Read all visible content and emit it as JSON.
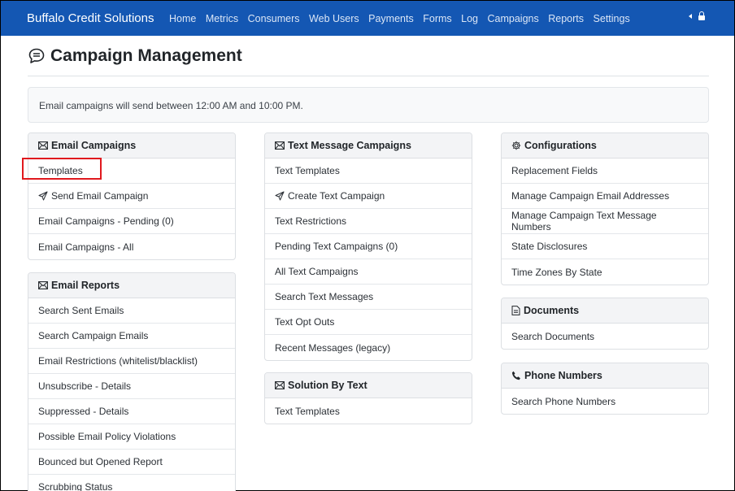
{
  "navbar": {
    "brand": "Buffalo Credit Solutions",
    "links": [
      "Home",
      "Metrics",
      "Consumers",
      "Web Users",
      "Payments",
      "Forms",
      "Log",
      "Campaigns",
      "Reports",
      "Settings"
    ],
    "right_icons": [
      "caret-left-icon",
      "lock-icon"
    ]
  },
  "page": {
    "title": "Campaign Management",
    "info": "Email campaigns will send between 12:00 AM and 10:00 PM."
  },
  "email_campaigns": {
    "title": "Email Campaigns",
    "items": [
      "Templates",
      "Send Email Campaign",
      "Email Campaigns - Pending (0)",
      "Email Campaigns - All"
    ]
  },
  "email_reports": {
    "title": "Email Reports",
    "items": [
      "Search Sent Emails",
      "Search Campaign Emails",
      "Email Restrictions (whitelist/blacklist)",
      "Unsubscribe - Details",
      "Suppressed - Details",
      "Possible Email Policy Violations",
      "Bounced but Opened Report",
      "Scrubbing Status"
    ]
  },
  "text_campaigns": {
    "title": "Text Message Campaigns",
    "items": [
      "Text Templates",
      "Create Text Campaign",
      "Text Restrictions",
      "Pending Text Campaigns (0)",
      "All Text Campaigns",
      "Search Text Messages",
      "Text Opt Outs",
      "Recent Messages (legacy)"
    ]
  },
  "solution_by_text": {
    "title": "Solution By Text",
    "items": [
      "Text Templates"
    ]
  },
  "configurations": {
    "title": "Configurations",
    "items": [
      "Replacement Fields",
      "Manage Campaign Email Addresses",
      "Manage Campaign Text Message Numbers",
      "State Disclosures",
      "Time Zones By State"
    ]
  },
  "documents": {
    "title": "Documents",
    "items": [
      "Search Documents"
    ]
  },
  "phone_numbers": {
    "title": "Phone Numbers",
    "items": [
      "Search Phone Numbers"
    ]
  },
  "colors": {
    "navbar": "#1457b3",
    "highlight": "#e0191e"
  }
}
